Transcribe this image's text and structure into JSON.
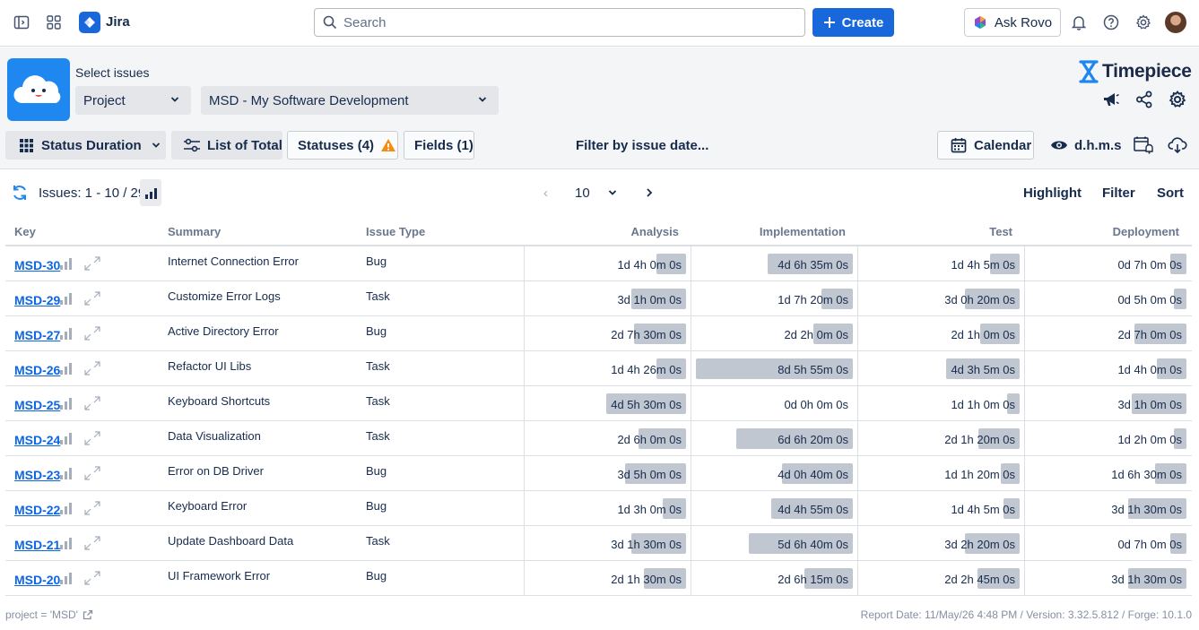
{
  "topbar": {
    "app_name": "Jira",
    "search_placeholder": "Search",
    "create_label": "Create",
    "rovo_label": "Ask Rovo"
  },
  "header": {
    "select_label": "Select issues",
    "scope_value": "Project",
    "project_value": "MSD - My Software Development",
    "brand": "Timepiece"
  },
  "controls": {
    "report_type": "Status Duration",
    "list_of_total": "List of Total",
    "statuses": "Statuses (4)",
    "fields": "Fields (1)",
    "filter_by_date": "Filter by issue date...",
    "calendar": "Calendar",
    "time_format": "d.h.m.s"
  },
  "toolbar": {
    "issues_count": "Issues: 1 - 10 / 29",
    "page_size": "10",
    "highlight": "Highlight",
    "filter": "Filter",
    "sort": "Sort"
  },
  "table": {
    "headers": {
      "key": "Key",
      "summary": "Summary",
      "issue_type": "Issue Type",
      "analysis": "Analysis",
      "implementation": "Implementation",
      "test": "Test",
      "deployment": "Deployment"
    },
    "rows": [
      {
        "key": "MSD-30",
        "summary": "Internet Connection Error",
        "type": "Bug",
        "analysis": "1d 4h 0m 0s",
        "implementation": "4d 6h 35m 0s",
        "test": "1d 4h 5m 0s",
        "deployment": "0d 7h 0m 0s",
        "fill": [
          0.19,
          0.54,
          0.19,
          0.1
        ]
      },
      {
        "key": "MSD-29",
        "summary": "Customize Error Logs",
        "type": "Task",
        "analysis": "3d 1h 0m 0s",
        "implementation": "1d 7h 20m 0s",
        "test": "3d 0h 20m 0s",
        "deployment": "0d 5h 0m 0s",
        "fill": [
          0.35,
          0.2,
          0.35,
          0.08
        ]
      },
      {
        "key": "MSD-27",
        "summary": "Active Directory Error",
        "type": "Bug",
        "analysis": "2d 7h 30m 0s",
        "implementation": "2d 2h 0m 0s",
        "test": "2d 1h 0m 0s",
        "deployment": "2d 7h 0m 0s",
        "fill": [
          0.33,
          0.25,
          0.25,
          0.33
        ]
      },
      {
        "key": "MSD-26",
        "summary": "Refactor UI Libs",
        "type": "Task",
        "analysis": "1d 4h 26m 0s",
        "implementation": "8d 5h 55m 0s",
        "test": "4d 3h 5m 0s",
        "deployment": "1d 4h 0m 0s",
        "fill": [
          0.19,
          1.0,
          0.47,
          0.19
        ]
      },
      {
        "key": "MSD-25",
        "summary": "Keyboard Shortcuts",
        "type": "Task",
        "analysis": "4d 5h 30m 0s",
        "implementation": "0d 0h 0m 0s",
        "test": "1d 1h 0m 0s",
        "deployment": "3d 1h 0m 0s",
        "fill": [
          0.51,
          0.0,
          0.08,
          0.35
        ]
      },
      {
        "key": "MSD-24",
        "summary": "Data Visualization",
        "type": "Task",
        "analysis": "2d 6h 0m 0s",
        "implementation": "6d 6h 20m 0s",
        "test": "2d 1h 20m 0s",
        "deployment": "1d 2h 0m 0s",
        "fill": [
          0.3,
          0.74,
          0.26,
          0.08
        ]
      },
      {
        "key": "MSD-23",
        "summary": "Error on DB Driver",
        "type": "Bug",
        "analysis": "3d 5h 0m 0s",
        "implementation": "4d 0h 40m 0s",
        "test": "1d 1h 20m 0s",
        "deployment": "1d 6h 30m 0s",
        "fill": [
          0.39,
          0.45,
          0.12,
          0.2
        ]
      },
      {
        "key": "MSD-22",
        "summary": "Keyboard Error",
        "type": "Bug",
        "analysis": "1d 3h 0m 0s",
        "implementation": "4d 4h 55m 0s",
        "test": "1d 4h 5m 0s",
        "deployment": "3d 1h 30m 0s",
        "fill": [
          0.15,
          0.52,
          0.1,
          0.37
        ]
      },
      {
        "key": "MSD-21",
        "summary": "Update Dashboard Data",
        "type": "Task",
        "analysis": "3d 1h 30m 0s",
        "implementation": "5d 6h 40m 0s",
        "test": "3d 2h 20m 0s",
        "deployment": "0d 7h 0m 0s",
        "fill": [
          0.35,
          0.66,
          0.35,
          0.1
        ]
      },
      {
        "key": "MSD-20",
        "summary": "UI Framework Error",
        "type": "Bug",
        "analysis": "2d 1h 30m 0s",
        "implementation": "2d 6h 15m 0s",
        "test": "2d 2h 45m 0s",
        "deployment": "3d 1h 30m 0s",
        "fill": [
          0.27,
          0.31,
          0.27,
          0.37
        ]
      }
    ]
  },
  "footer": {
    "jql": "project = 'MSD'",
    "report_info": "Report Date: 11/May/26 4:48 PM / Version: 3.32.5.812 / Forge: 10.1.0"
  },
  "colors": {
    "accent": "#1868db",
    "bar": "#c1c7d0",
    "link": "#0c66e4",
    "warning": "#f18d13"
  }
}
